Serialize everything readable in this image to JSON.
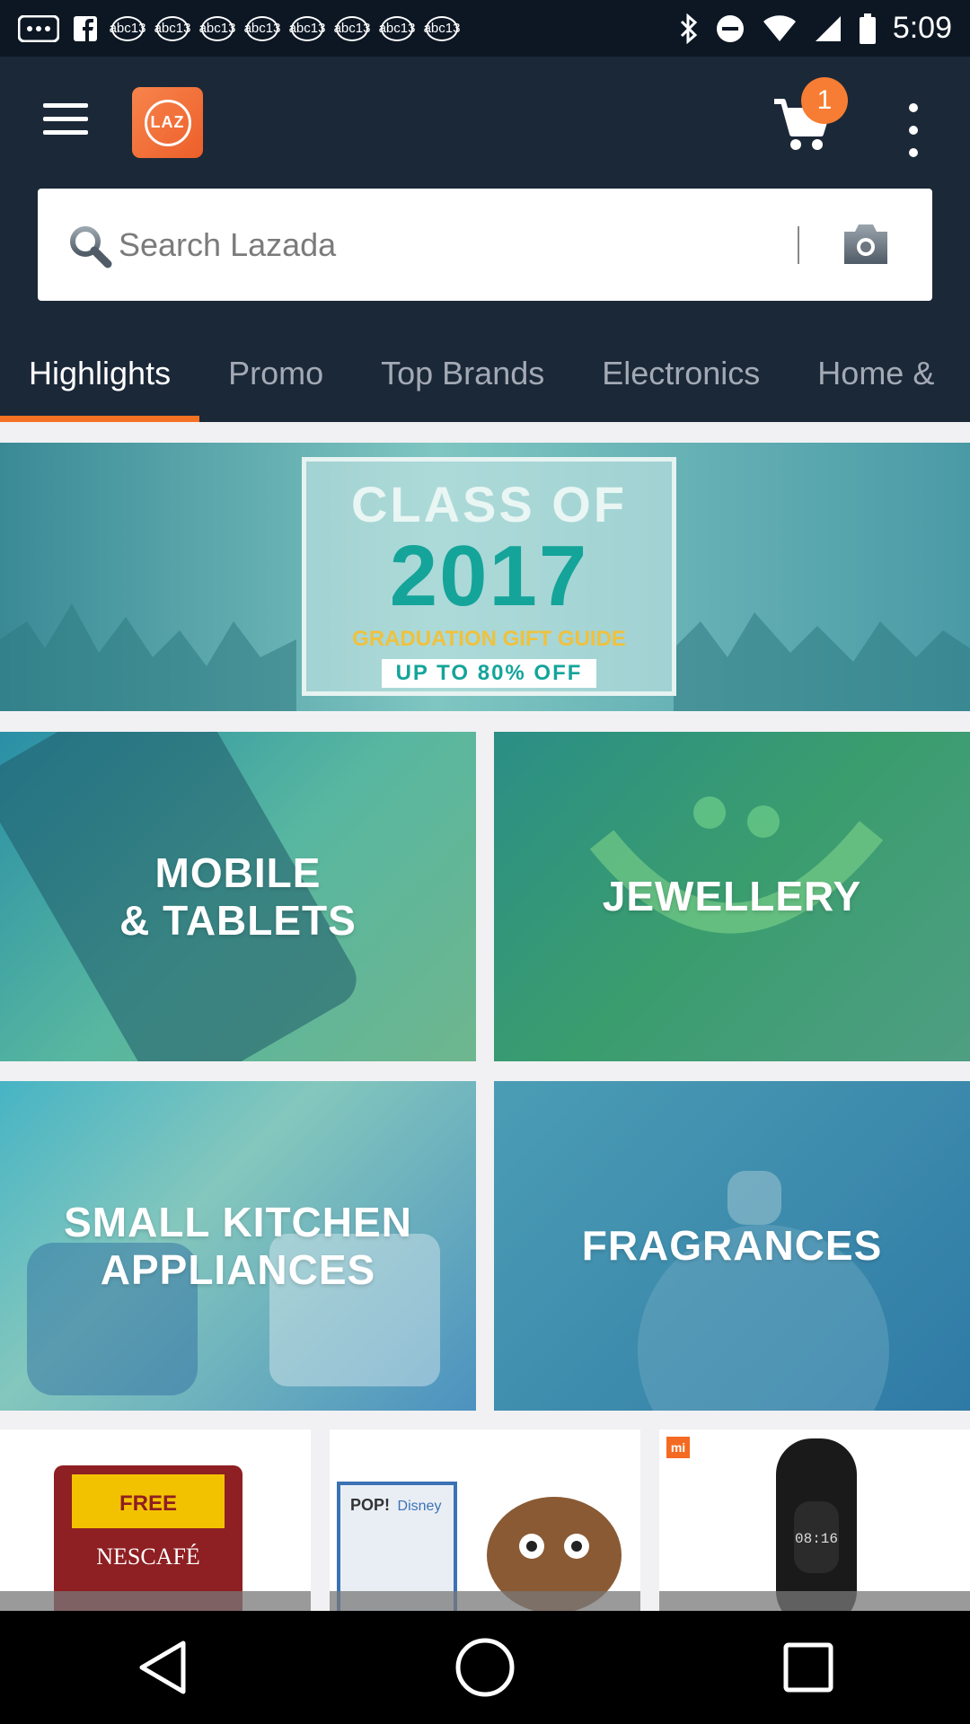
{
  "status_bar": {
    "time": "5:09",
    "notif_chip": "abc13",
    "icons": [
      "more-horiz-icon",
      "facebook-icon",
      "notification-chip-icon",
      "bluetooth-icon",
      "do-not-disturb-icon",
      "wifi-icon",
      "signal-icon",
      "battery-icon"
    ]
  },
  "app_bar": {
    "logo_text": "LAZ",
    "cart_count": "1",
    "search": {
      "placeholder": "Search Lazada",
      "value": ""
    },
    "tabs": [
      {
        "label": "Highlights",
        "active": true
      },
      {
        "label": "Promo",
        "active": false
      },
      {
        "label": "Top Brands",
        "active": false
      },
      {
        "label": "Electronics",
        "active": false
      },
      {
        "label": "Home &",
        "active": false
      }
    ],
    "accent_color": "#f57224"
  },
  "banner": {
    "line1": "CLASS OF",
    "line2": "2017",
    "line3": "GRADUATION GIFT GUIDE",
    "line4": "UP TO 80% OFF"
  },
  "categories": [
    {
      "label_line1": "MOBILE",
      "label_line2": "& TABLETS"
    },
    {
      "label_line1": "JEWELLERY",
      "label_line2": ""
    },
    {
      "label_line1": "SMALL KITCHEN",
      "label_line2": "APPLIANCES"
    },
    {
      "label_line1": "FRAGRANCES",
      "label_line2": ""
    }
  ],
  "products": [
    {
      "badge": "FREE",
      "brand": "NESCAFÉ"
    },
    {
      "badge": "POP!",
      "brand": "Disney"
    },
    {
      "badge": "mi",
      "brand": "08:16"
    }
  ],
  "nav_bar": {
    "icons": [
      "back-icon",
      "home-icon",
      "recents-icon"
    ]
  }
}
